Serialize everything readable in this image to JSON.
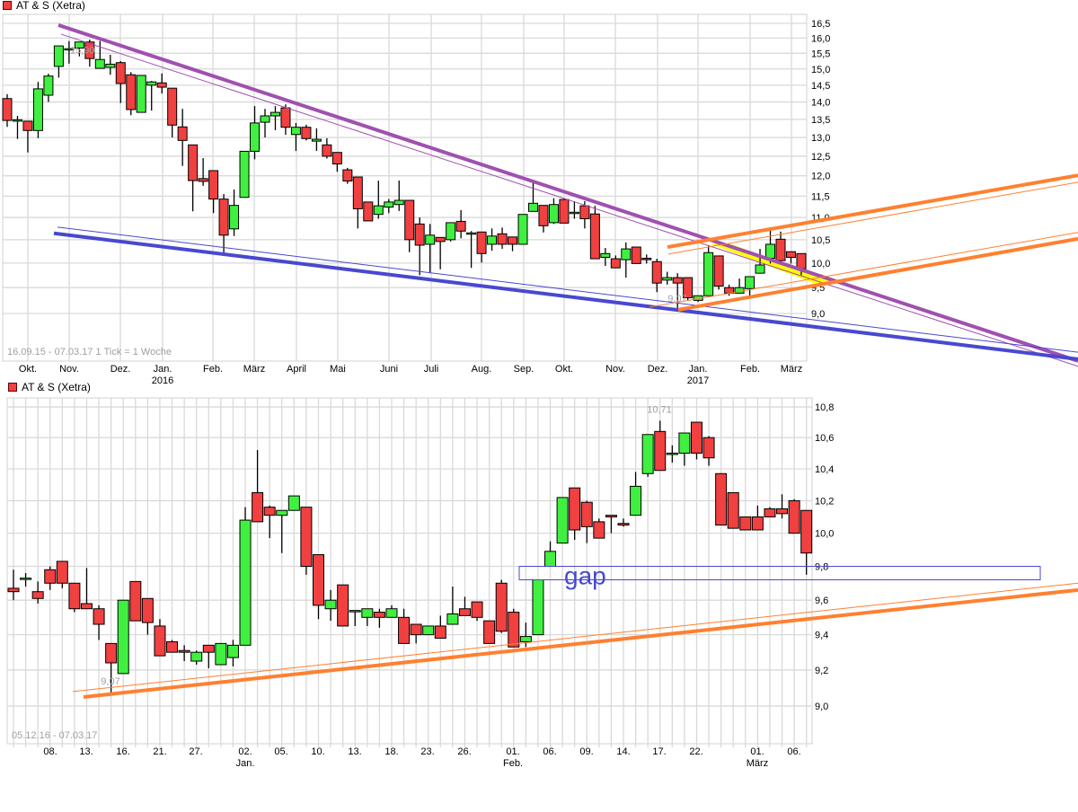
{
  "colors": {
    "up": "#40f040",
    "down": "#f04040",
    "grid": "#d9d9d9",
    "trend_purple": "#a050b0",
    "trend_blue": "#4848d0",
    "trend_orange": "#ff8030",
    "highlight": "#ffff00",
    "gap": "#4848d0",
    "note": "#a0a0a0"
  },
  "chart_data": [
    {
      "type": "candlestick",
      "title": "AT & S (Xetra)",
      "range_label": "16.09.15 - 07.03.17",
      "tick_label": "1 Tick = 1 Woche",
      "y_scale": "log",
      "ylim": [
        8.1,
        16.6
      ],
      "grid": true,
      "y_ticks": [
        {
          "value": 16.5,
          "label": "16,5"
        },
        {
          "value": 16.0,
          "label": "16,0"
        },
        {
          "value": 15.5,
          "label": "15,5"
        },
        {
          "value": 15.0,
          "label": "15,0"
        },
        {
          "value": 14.5,
          "label": "14,5"
        },
        {
          "value": 14.0,
          "label": "14,0"
        },
        {
          "value": 13.5,
          "label": "13,5"
        },
        {
          "value": 13.0,
          "label": "13,0"
        },
        {
          "value": 12.5,
          "label": "12,5"
        },
        {
          "value": 12.0,
          "label": "12,0"
        },
        {
          "value": 11.5,
          "label": "11,5"
        },
        {
          "value": 11.0,
          "label": "11,0"
        },
        {
          "value": 10.5,
          "label": "10,5"
        },
        {
          "value": 10.0,
          "label": "10,0"
        },
        {
          "value": 9.5,
          "label": "9,5"
        },
        {
          "value": 9.0,
          "label": "9,0"
        }
      ],
      "x_ticks": [
        {
          "label": "Okt.",
          "sub": ""
        },
        {
          "label": "Nov.",
          "sub": ""
        },
        {
          "label": "Dez.",
          "sub": ""
        },
        {
          "label": "Jan.",
          "sub": "2016"
        },
        {
          "label": "Feb.",
          "sub": ""
        },
        {
          "label": "März",
          "sub": ""
        },
        {
          "label": "April",
          "sub": ""
        },
        {
          "label": "Mai",
          "sub": ""
        },
        {
          "label": "Juni",
          "sub": ""
        },
        {
          "label": "Juli",
          "sub": ""
        },
        {
          "label": "Aug.",
          "sub": ""
        },
        {
          "label": "Sep.",
          "sub": ""
        },
        {
          "label": "Okt.",
          "sub": ""
        },
        {
          "label": "Nov.",
          "sub": ""
        },
        {
          "label": "Dez.",
          "sub": ""
        },
        {
          "label": "Jan.",
          "sub": "2017"
        },
        {
          "label": "Feb.",
          "sub": ""
        },
        {
          "label": "März",
          "sub": ""
        }
      ],
      "annotations": [
        {
          "label": "15,90",
          "value": 15.9
        },
        {
          "label": "9,07",
          "value": 9.07
        }
      ],
      "ohlc": [
        [
          14.1,
          14.23,
          13.29,
          13.47
        ],
        [
          13.45,
          13.6,
          12.96,
          13.49
        ],
        [
          13.45,
          13.45,
          12.6,
          13.19
        ],
        [
          13.19,
          14.6,
          12.98,
          14.39
        ],
        [
          14.2,
          14.85,
          14.0,
          14.78
        ],
        [
          15.08,
          15.74,
          14.73,
          15.74
        ],
        [
          15.65,
          15.9,
          15.17,
          15.65
        ],
        [
          15.67,
          15.87,
          15.4,
          15.87
        ],
        [
          15.87,
          15.95,
          15.07,
          15.33
        ],
        [
          15.02,
          15.9,
          15.02,
          15.3
        ],
        [
          15.05,
          15.45,
          14.82,
          15.15
        ],
        [
          15.2,
          15.25,
          13.97,
          14.55
        ],
        [
          14.82,
          14.9,
          13.62,
          13.78
        ],
        [
          13.7,
          14.8,
          13.7,
          14.8
        ],
        [
          14.5,
          14.63,
          13.75,
          14.6
        ],
        [
          14.57,
          14.86,
          14.25,
          14.44
        ],
        [
          14.41,
          14.41,
          13.0,
          13.34
        ],
        [
          13.29,
          13.8,
          12.25,
          12.92
        ],
        [
          12.8,
          12.8,
          11.14,
          11.88
        ],
        [
          11.93,
          12.45,
          11.75,
          11.86
        ],
        [
          12.13,
          12.13,
          11.1,
          11.43
        ],
        [
          11.43,
          11.55,
          10.2,
          10.6
        ],
        [
          10.74,
          11.66,
          10.58,
          11.28
        ],
        [
          11.47,
          12.63,
          11.47,
          12.63
        ],
        [
          12.63,
          13.88,
          12.42,
          13.4
        ],
        [
          13.42,
          13.8,
          13.0,
          13.6
        ],
        [
          13.6,
          13.88,
          13.2,
          13.7
        ],
        [
          13.83,
          13.93,
          13.07,
          13.28
        ],
        [
          13.08,
          13.4,
          12.64,
          13.28
        ],
        [
          13.28,
          13.35,
          12.92,
          12.97
        ],
        [
          12.9,
          13.25,
          12.64,
          12.95
        ],
        [
          12.8,
          12.98,
          12.44,
          12.5
        ],
        [
          12.6,
          12.6,
          12.1,
          12.3
        ],
        [
          12.15,
          12.2,
          11.8,
          11.87
        ],
        [
          11.97,
          11.97,
          10.75,
          11.2
        ],
        [
          11.36,
          11.36,
          10.92,
          10.92
        ],
        [
          11.07,
          11.88,
          10.97,
          11.27
        ],
        [
          11.24,
          11.43,
          11.1,
          11.36
        ],
        [
          11.3,
          11.88,
          11.15,
          11.4
        ],
        [
          11.4,
          11.4,
          10.23,
          10.5
        ],
        [
          10.85,
          11.0,
          9.75,
          10.38
        ],
        [
          10.4,
          10.85,
          9.8,
          10.6
        ],
        [
          10.55,
          10.55,
          9.87,
          10.46
        ],
        [
          10.5,
          10.88,
          10.46,
          10.88
        ],
        [
          10.91,
          11.17,
          10.53,
          10.69
        ],
        [
          10.65,
          10.69,
          9.9,
          10.65
        ],
        [
          10.67,
          10.67,
          10.01,
          10.2
        ],
        [
          10.4,
          10.75,
          10.26,
          10.58
        ],
        [
          10.63,
          10.77,
          10.3,
          10.4
        ],
        [
          10.56,
          10.56,
          10.25,
          10.4
        ],
        [
          10.4,
          11.07,
          10.4,
          11.07
        ],
        [
          11.14,
          11.9,
          11.14,
          11.33
        ],
        [
          11.28,
          11.28,
          10.66,
          10.81
        ],
        [
          10.88,
          11.45,
          10.85,
          11.3
        ],
        [
          11.42,
          11.45,
          10.87,
          10.87
        ],
        [
          11.12,
          11.38,
          10.97,
          11.12
        ],
        [
          11.27,
          11.38,
          10.75,
          10.97
        ],
        [
          11.08,
          11.27,
          10.09,
          10.09
        ],
        [
          10.12,
          10.32,
          9.94,
          10.2
        ],
        [
          10.09,
          10.16,
          9.9,
          9.9
        ],
        [
          10.07,
          10.44,
          9.7,
          10.3
        ],
        [
          10.34,
          10.34,
          9.99,
          9.99
        ],
        [
          10.1,
          10.18,
          9.99,
          10.07
        ],
        [
          10.03,
          10.09,
          9.41,
          9.59
        ],
        [
          9.65,
          9.82,
          9.56,
          9.7
        ],
        [
          9.7,
          9.79,
          9.07,
          9.59
        ],
        [
          9.7,
          9.7,
          9.24,
          9.3
        ],
        [
          9.25,
          9.34,
          9.22,
          9.34
        ],
        [
          9.34,
          10.38,
          9.34,
          10.22
        ],
        [
          10.15,
          10.15,
          9.46,
          9.53
        ],
        [
          9.5,
          9.56,
          9.34,
          9.39
        ],
        [
          9.39,
          9.68,
          9.39,
          9.5
        ],
        [
          9.48,
          9.72,
          9.31,
          9.72
        ],
        [
          9.79,
          10.3,
          9.79,
          9.96
        ],
        [
          10.1,
          10.71,
          9.99,
          10.4
        ],
        [
          10.51,
          10.68,
          10.05,
          10.05
        ],
        [
          10.24,
          10.24,
          9.99,
          10.12
        ],
        [
          10.2,
          10.2,
          9.75,
          9.88
        ]
      ],
      "trendlines": [
        {
          "color": "trend_purple",
          "weight": "thick",
          "from_price": 16.44,
          "to_price": 8.15
        },
        {
          "color": "trend_purple",
          "weight": "thin",
          "from_price": 16.13,
          "to_price": 8.06
        },
        {
          "color": "trend_blue",
          "weight": "thick",
          "from_price": 10.64,
          "to_price": 8.18
        },
        {
          "color": "trend_blue",
          "weight": "thin",
          "from_price": 10.78,
          "to_price": 8.3
        },
        {
          "color": "trend_orange",
          "weight": "thick",
          "from_price": 10.34,
          "to_price": 12.01
        },
        {
          "color": "trend_orange",
          "weight": "thin",
          "from_price": 10.19,
          "to_price": 11.84
        },
        {
          "color": "trend_orange",
          "weight": "thick",
          "from_price": 9.07,
          "to_price": 10.52
        },
        {
          "color": "trend_orange",
          "weight": "thin",
          "from_price": 9.12,
          "to_price": 10.66
        }
      ]
    },
    {
      "type": "candlestick",
      "title": "AT & S (Xetra)",
      "range_label": "05.12.16 - 07.03.17",
      "y_scale": "log",
      "ylim": [
        8.85,
        10.85
      ],
      "grid": true,
      "y_ticks": [
        {
          "value": 10.8,
          "label": "10,8"
        },
        {
          "value": 10.6,
          "label": "10,6"
        },
        {
          "value": 10.4,
          "label": "10,4"
        },
        {
          "value": 10.2,
          "label": "10,2"
        },
        {
          "value": 10.0,
          "label": "10,0"
        },
        {
          "value": 9.8,
          "label": "9,8"
        },
        {
          "value": 9.6,
          "label": "9,6"
        },
        {
          "value": 9.4,
          "label": "9,4"
        },
        {
          "value": 9.2,
          "label": "9,2"
        },
        {
          "value": 9.0,
          "label": "9,0"
        }
      ],
      "x_ticks": [
        {
          "label": "08.",
          "sub": ""
        },
        {
          "label": "13.",
          "sub": ""
        },
        {
          "label": "16.",
          "sub": ""
        },
        {
          "label": "21.",
          "sub": ""
        },
        {
          "label": "27.",
          "sub": ""
        },
        {
          "label": "02.",
          "sub": "Jan."
        },
        {
          "label": "05.",
          "sub": ""
        },
        {
          "label": "10.",
          "sub": ""
        },
        {
          "label": "13.",
          "sub": ""
        },
        {
          "label": "18.",
          "sub": ""
        },
        {
          "label": "23.",
          "sub": ""
        },
        {
          "label": "26.",
          "sub": ""
        },
        {
          "label": "01.",
          "sub": "Feb."
        },
        {
          "label": "06.",
          "sub": ""
        },
        {
          "label": "09.",
          "sub": ""
        },
        {
          "label": "14.",
          "sub": ""
        },
        {
          "label": "17.",
          "sub": ""
        },
        {
          "label": "22.",
          "sub": ""
        },
        {
          "label": "01.",
          "sub": "März"
        },
        {
          "label": "06.",
          "sub": ""
        }
      ],
      "annotations": [
        {
          "label": "9,07",
          "value": 9.07
        },
        {
          "label": "10,71",
          "value": 10.71
        }
      ],
      "gap": {
        "label": "gap",
        "upper": 9.8,
        "lower": 9.72
      },
      "ohlc": [
        [
          9.67,
          9.78,
          9.6,
          9.65
        ],
        [
          9.73,
          9.76,
          9.68,
          9.73
        ],
        [
          9.65,
          9.71,
          9.58,
          9.61
        ],
        [
          9.78,
          9.8,
          9.66,
          9.7
        ],
        [
          9.83,
          9.83,
          9.67,
          9.7
        ],
        [
          9.7,
          9.7,
          9.53,
          9.55
        ],
        [
          9.58,
          9.79,
          9.55,
          9.55
        ],
        [
          9.55,
          9.57,
          9.37,
          9.46
        ],
        [
          9.35,
          9.35,
          9.07,
          9.24
        ],
        [
          9.18,
          9.6,
          9.18,
          9.6
        ],
        [
          9.71,
          9.71,
          9.48,
          9.48
        ],
        [
          9.61,
          9.61,
          9.4,
          9.47
        ],
        [
          9.45,
          9.49,
          9.28,
          9.28
        ],
        [
          9.36,
          9.37,
          9.3,
          9.3
        ],
        [
          9.31,
          9.34,
          9.25,
          9.3
        ],
        [
          9.25,
          9.31,
          9.23,
          9.3
        ],
        [
          9.34,
          9.34,
          9.21,
          9.3
        ],
        [
          9.23,
          9.35,
          9.23,
          9.35
        ],
        [
          9.27,
          9.37,
          9.22,
          9.34
        ],
        [
          9.34,
          10.16,
          9.34,
          10.08
        ],
        [
          10.25,
          10.52,
          10.07,
          10.07
        ],
        [
          10.16,
          10.17,
          9.97,
          10.11
        ],
        [
          10.11,
          10.14,
          9.88,
          10.14
        ],
        [
          10.14,
          10.23,
          10.14,
          10.23
        ],
        [
          10.16,
          10.16,
          9.75,
          9.8
        ],
        [
          9.87,
          9.87,
          9.49,
          9.57
        ],
        [
          9.55,
          9.66,
          9.48,
          9.6
        ],
        [
          9.69,
          9.69,
          9.45,
          9.45
        ],
        [
          9.54,
          9.54,
          9.45,
          9.54
        ],
        [
          9.5,
          9.55,
          9.45,
          9.55
        ],
        [
          9.53,
          9.55,
          9.44,
          9.5
        ],
        [
          9.5,
          9.57,
          9.5,
          9.55
        ],
        [
          9.5,
          9.55,
          9.35,
          9.35
        ],
        [
          9.46,
          9.46,
          9.35,
          9.4
        ],
        [
          9.4,
          9.45,
          9.4,
          9.45
        ],
        [
          9.45,
          9.51,
          9.38,
          9.38
        ],
        [
          9.46,
          9.68,
          9.46,
          9.52
        ],
        [
          9.55,
          9.62,
          9.51,
          9.51
        ],
        [
          9.59,
          9.59,
          9.48,
          9.5
        ],
        [
          9.48,
          9.48,
          9.35,
          9.35
        ],
        [
          9.7,
          9.72,
          9.41,
          9.42
        ],
        [
          9.53,
          9.55,
          9.33,
          9.33
        ],
        [
          9.36,
          9.47,
          9.33,
          9.39
        ],
        [
          9.4,
          9.72,
          9.4,
          9.72
        ],
        [
          9.8,
          9.95,
          9.8,
          9.89
        ],
        [
          9.94,
          10.22,
          9.94,
          10.22
        ],
        [
          10.28,
          10.28,
          9.96,
          10.02
        ],
        [
          10.19,
          10.2,
          9.94,
          10.04
        ],
        [
          10.07,
          10.09,
          9.97,
          9.97
        ],
        [
          10.11,
          10.11,
          10.0,
          10.1
        ],
        [
          10.06,
          10.09,
          10.04,
          10.05
        ],
        [
          10.11,
          10.38,
          10.11,
          10.29
        ],
        [
          10.37,
          10.62,
          10.35,
          10.62
        ],
        [
          10.64,
          10.71,
          10.39,
          10.39
        ],
        [
          10.5,
          10.55,
          10.44,
          10.5
        ],
        [
          10.5,
          10.63,
          10.42,
          10.63
        ],
        [
          10.7,
          10.7,
          10.46,
          10.5
        ],
        [
          10.6,
          10.61,
          10.42,
          10.47
        ],
        [
          10.37,
          10.37,
          10.05,
          10.05
        ],
        [
          10.25,
          10.25,
          10.03,
          10.03
        ],
        [
          10.1,
          10.1,
          10.02,
          10.02
        ],
        [
          10.1,
          10.17,
          10.02,
          10.02
        ],
        [
          10.15,
          10.16,
          10.1,
          10.1
        ],
        [
          10.15,
          10.24,
          10.09,
          10.12
        ],
        [
          10.2,
          10.21,
          10.0,
          10.0
        ],
        [
          10.14,
          10.14,
          9.75,
          9.88
        ]
      ],
      "trendlines": [
        {
          "color": "trend_orange",
          "weight": "thick",
          "from_price": 9.05,
          "to_price": 9.66
        },
        {
          "color": "trend_orange",
          "weight": "thin",
          "from_price": 9.08,
          "to_price": 9.7
        }
      ]
    }
  ]
}
